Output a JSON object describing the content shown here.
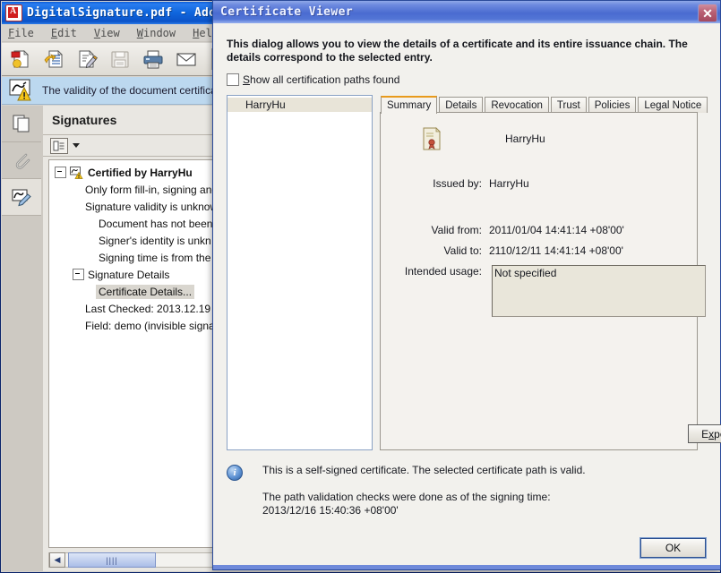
{
  "acrobat": {
    "title": "DigitalSignature.pdf - Ado",
    "title_icon": "pdf-document-icon",
    "menus": [
      {
        "label": "File",
        "accel": "F"
      },
      {
        "label": "Edit",
        "accel": "E"
      },
      {
        "label": "View",
        "accel": "V"
      },
      {
        "label": "Window",
        "accel": "W"
      },
      {
        "label": "Help",
        "accel": "H"
      }
    ],
    "toolbar_icons": [
      "create-pdf-icon",
      "combine-files-icon",
      "comment-markup-icon",
      "save-icon",
      "print-icon",
      "email-icon",
      "clock-icon"
    ],
    "notification": {
      "icon": "signature-warning-icon",
      "text": "The validity of the document certificati"
    },
    "navtabs": [
      {
        "name": "pages-icon",
        "label": "Pages",
        "active": false
      },
      {
        "name": "attachments-icon",
        "label": "Attachments",
        "active": false
      },
      {
        "name": "signatures-icon",
        "label": "Signatures",
        "active": true
      }
    ],
    "signatures_panel": {
      "header": "Signatures",
      "options_button": "options-menu-button",
      "tree": [
        {
          "text": "Certified by HarryHu",
          "indent": 0,
          "bold": true,
          "expander": true,
          "icon": true,
          "selected": false
        },
        {
          "text": "Only form fill-in, signing and",
          "indent": 2,
          "bold": false,
          "expander": false,
          "icon": false,
          "selected": false
        },
        {
          "text": "Signature validity is unknow",
          "indent": 2,
          "bold": false,
          "expander": false,
          "icon": false,
          "selected": false
        },
        {
          "text": "Document has not been",
          "indent": 3,
          "bold": false,
          "expander": false,
          "icon": false,
          "selected": false
        },
        {
          "text": "Signer's identity is unkn",
          "indent": 3,
          "bold": false,
          "expander": false,
          "icon": false,
          "selected": false
        },
        {
          "text": "Signing time is from the",
          "indent": 3,
          "bold": false,
          "expander": false,
          "icon": false,
          "selected": false
        },
        {
          "text": "Signature Details",
          "indent": 1,
          "bold": false,
          "expander": true,
          "icon": false,
          "selected": false
        },
        {
          "text": "Certificate Details...",
          "indent": 3,
          "bold": false,
          "expander": false,
          "icon": false,
          "selected": true
        },
        {
          "text": "Last Checked: 2013.12.19",
          "indent": 2,
          "bold": false,
          "expander": false,
          "icon": false,
          "selected": false
        },
        {
          "text": "Field: demo (invisible signat",
          "indent": 2,
          "bold": false,
          "expander": false,
          "icon": false,
          "selected": false
        }
      ],
      "hscroll": {
        "arrow": "◀",
        "thumb": "||||"
      }
    }
  },
  "dialog": {
    "title": "Certificate Viewer",
    "close_label": "✕",
    "intro": "This dialog allows you to view the details of a certificate and its entire issuance chain. The details correspond to the selected entry.",
    "show_all_paths": {
      "label_prefix": "S",
      "label_rest": "how all certification paths found",
      "checked": false
    },
    "cert_list": [
      {
        "label": "HarryHu",
        "selected": true
      }
    ],
    "tabs": [
      {
        "label": "Summary",
        "active": true
      },
      {
        "label": "Details",
        "active": false
      },
      {
        "label": "Revocation",
        "active": false
      },
      {
        "label": "Trust",
        "active": false
      },
      {
        "label": "Policies",
        "active": false
      },
      {
        "label": "Legal Notice",
        "active": false
      }
    ],
    "summary": {
      "icon": "certificate-seal-icon",
      "subject_name": "HarryHu",
      "fields": [
        {
          "label": "Issued by:",
          "value": "HarryHu"
        },
        {
          "label": "Valid from:",
          "value": "2011/01/04 14:41:14 +08'00'"
        },
        {
          "label": "Valid to:",
          "value": "2110/12/11 14:41:14 +08'00'"
        }
      ],
      "usage_label": "Intended usage:",
      "usage_value": "Not specified",
      "export_button_prefix": "E",
      "export_button_accel": "x",
      "export_button_rest": "port..."
    },
    "status": {
      "icon": "info-icon",
      "line1": "This is a self-signed certificate. The selected certificate path is valid.",
      "line2a": "The path validation checks were done as of the signing time:",
      "line2b": "2013/12/16 15:40:36 +08'00'"
    },
    "ok_button": "OK"
  },
  "colors": {
    "dialog_titlebar": "#4a6bd0",
    "acrobat_titlebar": "#0f66dd",
    "active_tab_accent": "#e89a1c",
    "notification_bar": "#bcd8ef",
    "selection": "#e8e4d8"
  }
}
